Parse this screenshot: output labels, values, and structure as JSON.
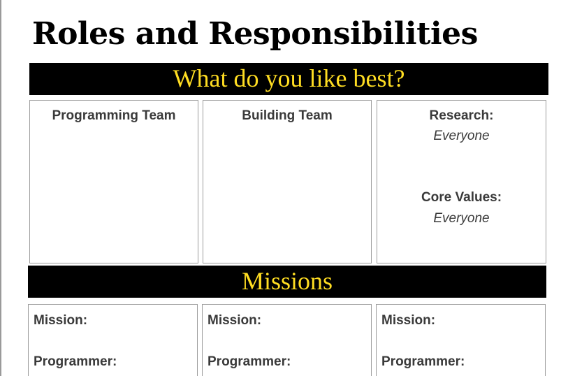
{
  "document": {
    "title": "Roles and Responsibilities"
  },
  "preferences": {
    "heading": "What do you like best?",
    "columns": [
      {
        "label": "Programming Team"
      },
      {
        "label": "Building Team"
      },
      {
        "research_label": "Research:",
        "research_value": "Everyone",
        "core_values_label": "Core Values:",
        "core_values_value": "Everyone"
      }
    ]
  },
  "missions": {
    "heading": "Missions",
    "cards": [
      {
        "mission_label": "Mission:",
        "programmer_label": "Programmer:"
      },
      {
        "mission_label": "Mission:",
        "programmer_label": "Programmer:"
      },
      {
        "mission_label": "Mission:",
        "programmer_label": "Programmer:"
      }
    ]
  },
  "colors": {
    "banner_background": "#000000",
    "banner_text": "#ffdd22",
    "box_border": "#9c9c9c",
    "body_text": "#3a3a3a"
  }
}
